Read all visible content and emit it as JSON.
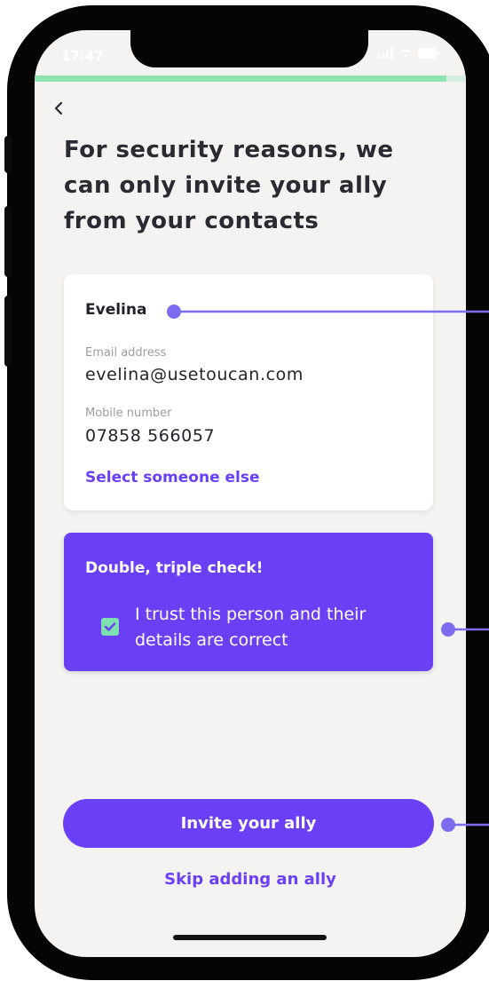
{
  "status_bar": {
    "time": "17:47"
  },
  "progress": {
    "value": 0.955,
    "fill_color": "#8de3b1"
  },
  "nav": {
    "back_icon": "chevron-left-icon"
  },
  "title": "For security reasons, we can only invite your ally from your contacts",
  "contact_card": {
    "name": "Evelina",
    "email_label": "Email address",
    "email_value": "evelina@usetoucan.com",
    "mobile_label": "Mobile number",
    "mobile_value": "07858 566057",
    "select_link": "Select someone else"
  },
  "confirm_card": {
    "heading": "Double, triple check!",
    "checkbox_checked": true,
    "checkbox_label": "I trust this person and their details are correct"
  },
  "actions": {
    "primary_label": "Invite your ally",
    "secondary_label": "Skip adding an ally"
  },
  "colors": {
    "accent": "#6a3ff5",
    "success": "#7ee0b0",
    "background": "#f4f3f1",
    "annotation": "#7b6cf0"
  }
}
